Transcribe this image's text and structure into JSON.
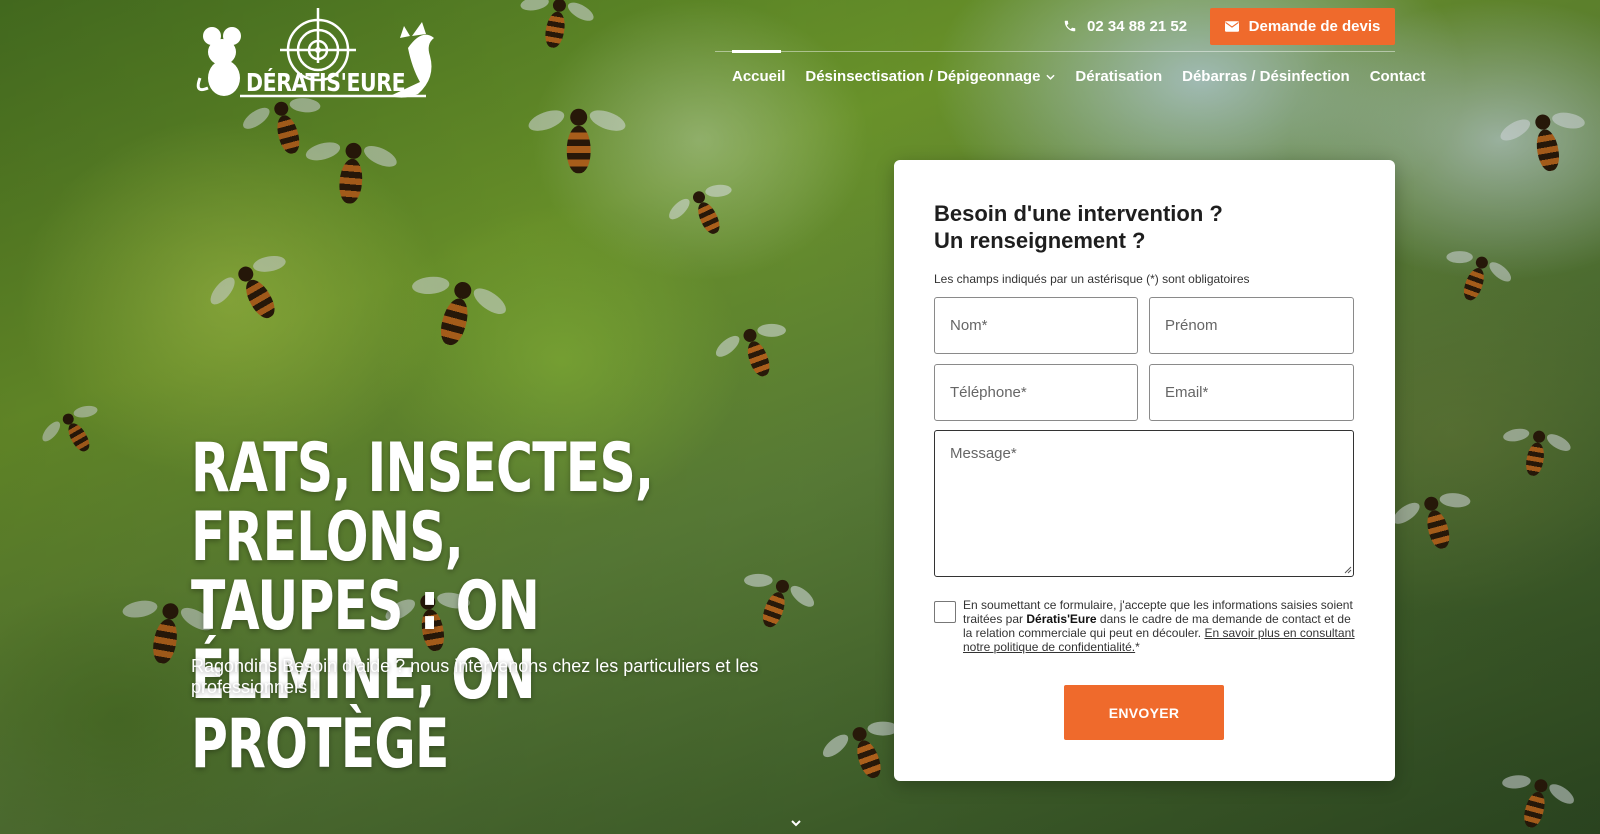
{
  "brand": {
    "name": "DÉRATIS'EURE"
  },
  "topbar": {
    "phone": "02 34 88 21 52",
    "quote_label": "Demande de devis"
  },
  "nav": {
    "items": [
      {
        "label": "Accueil",
        "active": true
      },
      {
        "label": "Désinsectisation / Dépigeonnage",
        "has_dropdown": true
      },
      {
        "label": "Dératisation"
      },
      {
        "label": "Débarras / Désinfection"
      },
      {
        "label": "Contact"
      }
    ]
  },
  "hero": {
    "title_line1": "Rats, insectes, frelons,",
    "title_line2": "taupes : on élimine, on",
    "title_line3": "protège",
    "subtitle": "Ragondins Besoin d’aide ? nous intervenons chez les particuliers et les professionnels !"
  },
  "form": {
    "title_line1": "Besoin d'une intervention ?",
    "title_line2": "Un renseignement ?",
    "required_note": "Les champs indiqués par un astérisque (*) sont obligatoires",
    "fields": {
      "nom": "Nom*",
      "prenom": "Prénom",
      "telephone": "Téléphone*",
      "email": "Email*",
      "message": "Message*"
    },
    "consent_pre": "En soumettant ce formulaire, j'accepte que les informations saisies soient traitées par ",
    "consent_brand": "Dératis'Eure",
    "consent_mid": " dans le cadre de ma demande de contact et de la relation commerciale qui peut en découler. ",
    "consent_link": "En savoir plus en consultant notre politique de confidentialité.",
    "consent_suffix": "*",
    "submit_label": "ENVOYER"
  },
  "colors": {
    "accent": "#ef6a2c",
    "card_bg": "#ffffff",
    "text_dark": "#1e1e1e"
  },
  "icons": {
    "phone": "phone-icon",
    "mail": "mail-icon",
    "dropdown": "chevron-down-icon",
    "scroll": "scroll-down-icon"
  }
}
